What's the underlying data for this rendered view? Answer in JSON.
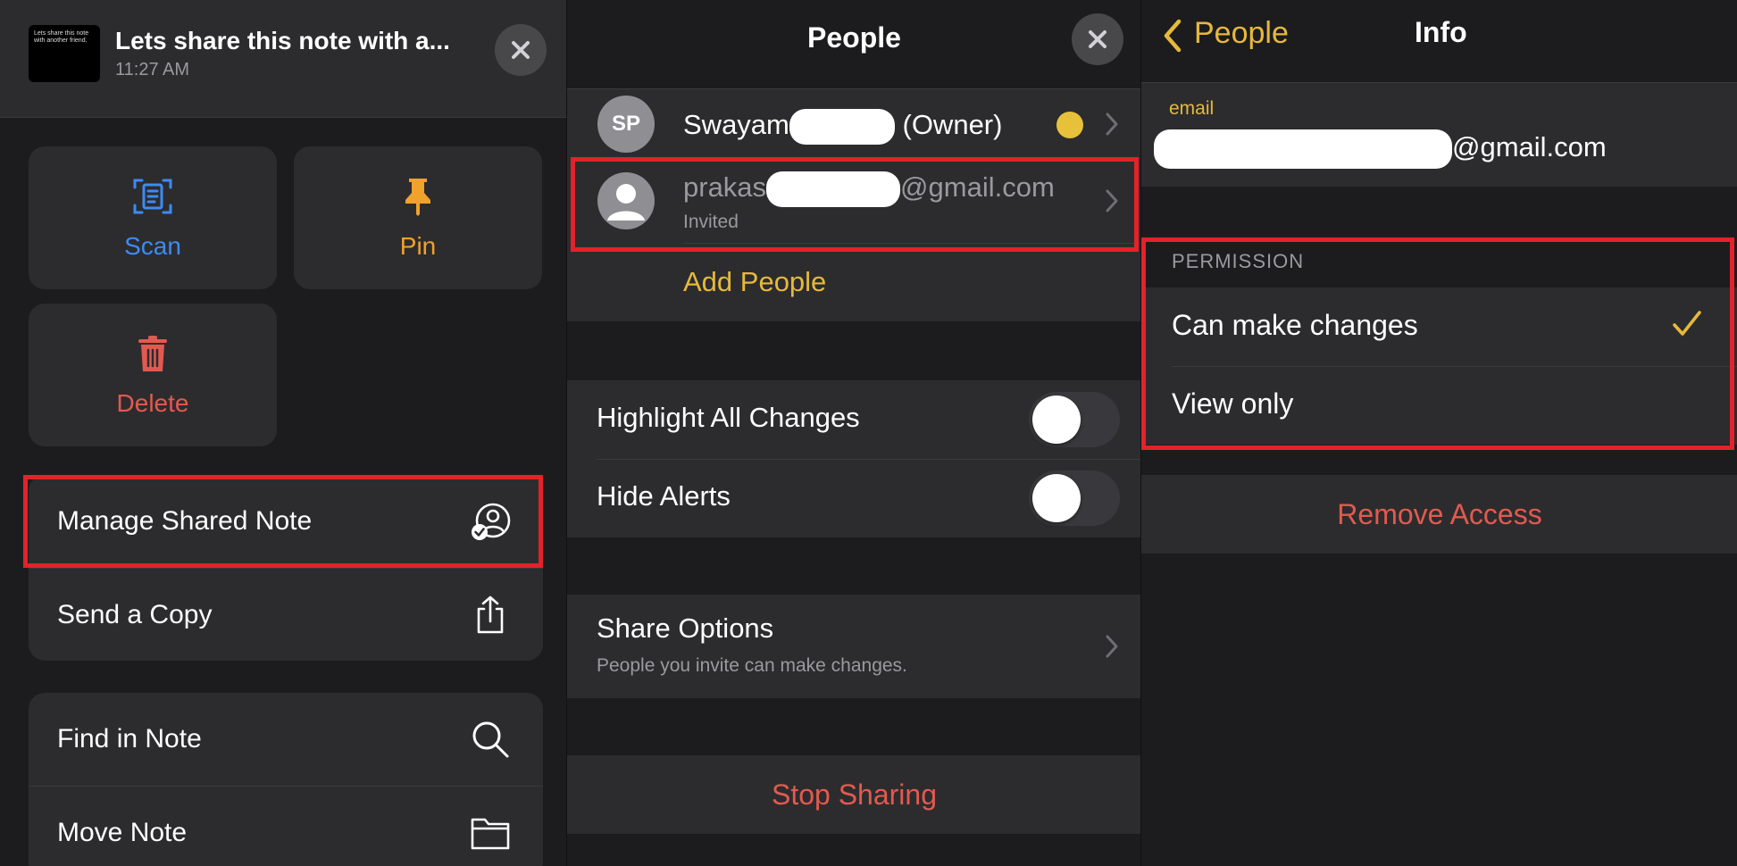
{
  "left_panel": {
    "thumbnail_text": "Lets share this note with another friend.",
    "note_title": "Lets share this note with a...",
    "note_time": "11:27 AM",
    "tiles": {
      "scan": "Scan",
      "pin": "Pin",
      "delete": "Delete"
    },
    "rows": {
      "manage_shared_note": "Manage Shared Note",
      "send_a_copy": "Send a Copy",
      "find_in_note": "Find in Note",
      "move_note": "Move Note"
    }
  },
  "middle_panel": {
    "title": "People",
    "owner": {
      "initials": "SP",
      "name_prefix": "Swayam",
      "name_suffix": "(Owner)"
    },
    "invitee": {
      "email_prefix": "prakas",
      "email_suffix": "@gmail.com",
      "status": "Invited"
    },
    "add_people": "Add People",
    "toggles": {
      "highlight_all_changes": {
        "label": "Highlight All Changes",
        "on": false
      },
      "hide_alerts": {
        "label": "Hide Alerts",
        "on": false
      }
    },
    "share_options": {
      "title": "Share Options",
      "subtitle": "People you invite can make changes."
    },
    "stop_sharing": "Stop Sharing"
  },
  "right_panel": {
    "back_label": "People",
    "title": "Info",
    "email_label": "email",
    "email_suffix": "@gmail.com",
    "permission_header": "PERMISSION",
    "options": {
      "can_make_changes": "Can make changes",
      "view_only": "View only"
    },
    "selected_option": "Can make changes",
    "remove_access": "Remove Access"
  },
  "colors": {
    "accent_yellow": "#e6b93c",
    "scan_blue": "#3d8bf2",
    "pin_orange": "#f0a22c",
    "delete_red": "#e25a4f",
    "highlight_red": "#e3222a",
    "owner_dot": "#e6c139"
  }
}
